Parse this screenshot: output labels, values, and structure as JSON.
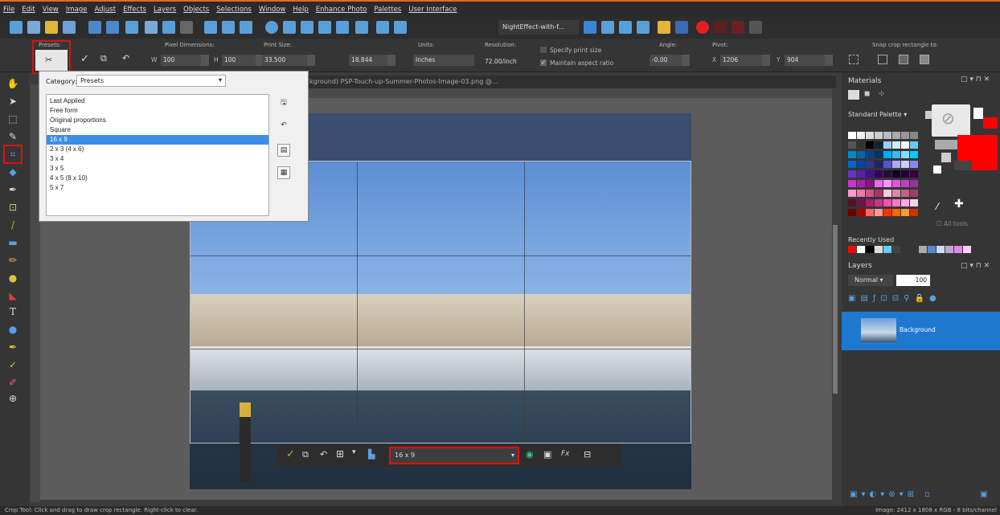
{
  "menu": [
    "File",
    "Edit",
    "View",
    "Image",
    "Adjust",
    "Effects",
    "Layers",
    "Objects",
    "Selections",
    "Window",
    "Help",
    "Enhance Photo",
    "Palettes",
    "User Interface"
  ],
  "toolbar": {
    "script_name": "NightEffect-with-f..."
  },
  "options": {
    "presets_label": "Presets:",
    "pixel_dim_label": "Pixel Dimensions:",
    "w_label": "W",
    "w_value": "100",
    "h_label": "H",
    "h_value": "100",
    "print_size_label": "Print Size:",
    "pw_value": "33.500",
    "ph_value": "18.844",
    "units_label": "Units:",
    "units_value": "Inches",
    "resolution_label": "Resolution:",
    "resolution_value": "72.00/inch",
    "specify_print": "Specify print size",
    "maintain_aspect": "Maintain aspect ratio",
    "angle_label": "Angle:",
    "angle_value": "-0.00",
    "pivot_label": "Pivot:",
    "x_label": "X",
    "x_value": "1206",
    "y_label": "Y",
    "y_value": "904",
    "snap_label": "Snap crop rectangle to:"
  },
  "doc_tab": "kground)   PSP-Touch-up-Summer-Photos-Image-03.png  @...",
  "preset_popup": {
    "category_label": "Category:",
    "category_value": "Presets",
    "items": [
      "Last Applied",
      "Free form",
      "Original proportions",
      "Square",
      "16 x 9",
      "2 x 3 (4 x 6)",
      "3 x 4",
      "3 x 5",
      "4 x 5 (8 x 10)",
      "5 x 7"
    ],
    "selected": "16 x 9"
  },
  "crop_toolbar": {
    "preset_value": "16 x 9",
    "fx_label": "Fx"
  },
  "materials": {
    "title": "Materials",
    "palette_select": "Standard Palette",
    "all_tools": "All tools",
    "recently_used": "Recently Used",
    "fg_color": "#ffffff",
    "bg_color": "#ff0000"
  },
  "layers": {
    "title": "Layers",
    "blend_mode": "Normal",
    "opacity": "100",
    "layer_name": "Background"
  },
  "status": {
    "left": "Crop Tool: Click and drag to draw crop rectangle. Right-click to clear.",
    "right": "Image:  2412 x 1808 x RGB - 8 bits/channel"
  }
}
